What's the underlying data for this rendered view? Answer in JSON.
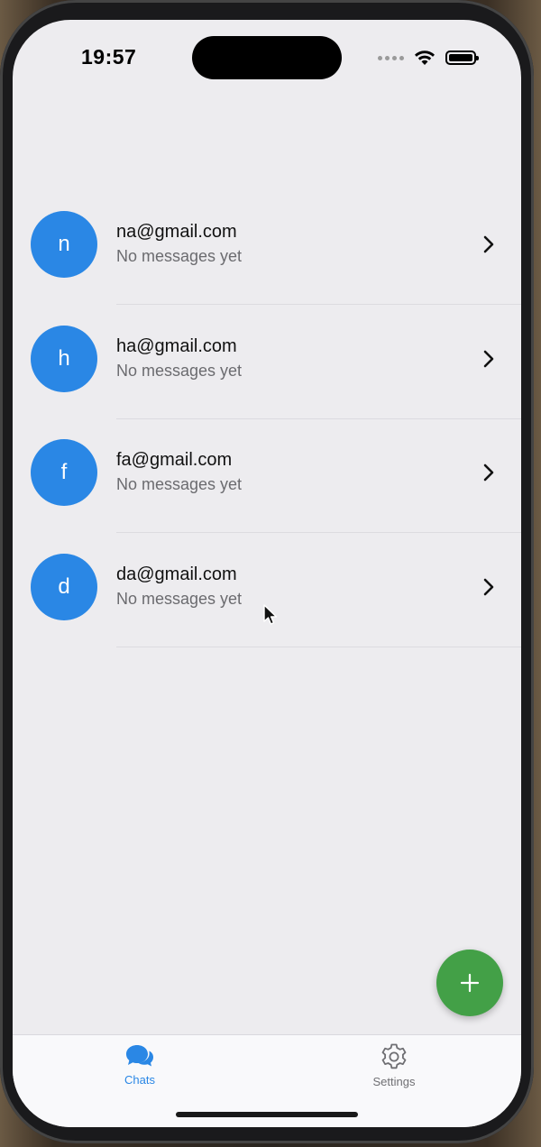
{
  "status_bar": {
    "time": "19:57"
  },
  "chats": [
    {
      "initial": "n",
      "title": "na@gmail.com",
      "subtitle": "No messages yet"
    },
    {
      "initial": "h",
      "title": "ha@gmail.com",
      "subtitle": "No messages yet"
    },
    {
      "initial": "f",
      "title": "fa@gmail.com",
      "subtitle": "No messages yet"
    },
    {
      "initial": "d",
      "title": "da@gmail.com",
      "subtitle": "No messages yet"
    }
  ],
  "tab_bar": {
    "chats_label": "Chats",
    "settings_label": "Settings",
    "selected": "Chats"
  },
  "icons": {
    "chats_tab": "chat-bubbles-icon",
    "settings_tab": "gear-icon",
    "fab": "plus-icon",
    "row_disclosure": "chevron-right-icon"
  },
  "colors": {
    "accent": "#2a87e5",
    "avatar": "#2a87e5",
    "fab": "#43a047",
    "background": "#edecef"
  }
}
